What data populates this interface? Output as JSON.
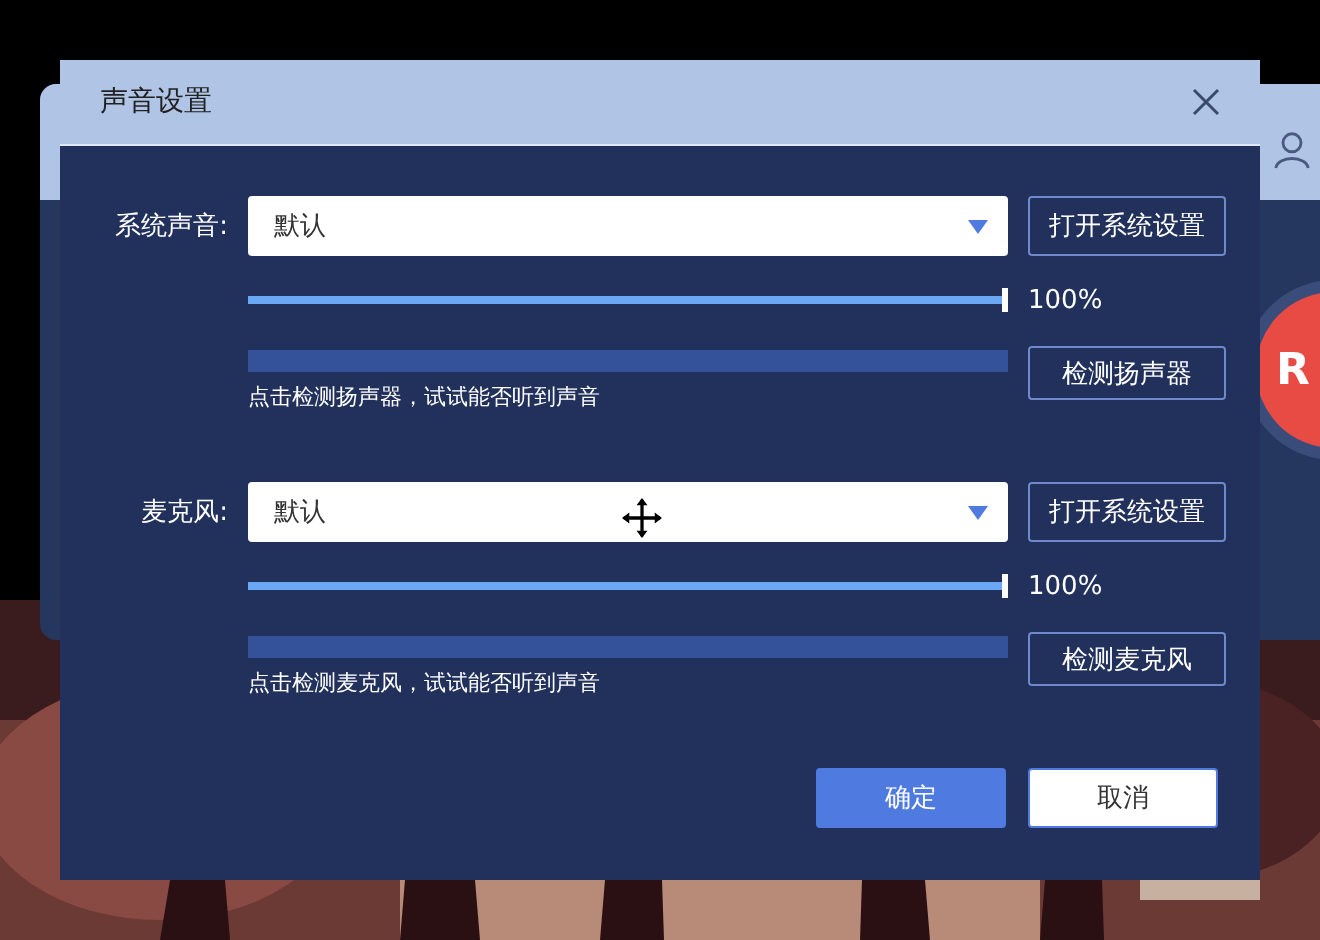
{
  "background_app": {
    "badge": "R"
  },
  "window": {
    "title": "声音设置"
  },
  "sections": [
    {
      "label": "系统声音:",
      "device": "默认",
      "open_button": "打开系统设置",
      "volume": {
        "level": 1
      },
      "reading": "100%",
      "test_meter": {
        "level": 0
      },
      "test_button": "检测扬声器",
      "hint": "点击检测扬声器，试试能否听到声音"
    },
    {
      "label": "麦克风:",
      "device": "默认",
      "open_button": "打开系统设置",
      "volume": {
        "level": 1
      },
      "reading": "100%",
      "test_meter": {
        "level": 0
      },
      "test_button": "检测麦克风",
      "hint": "点击检测麦克风，试试能否听到声音"
    }
  ],
  "buttons": [
    {
      "label": "确定",
      "kind": "primary"
    },
    {
      "label": "取消",
      "kind": "secondary"
    }
  ]
}
